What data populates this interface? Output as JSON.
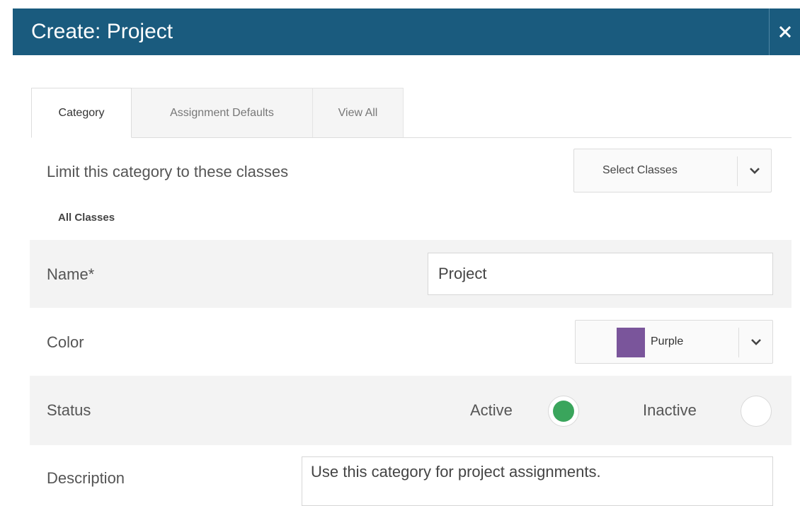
{
  "dialog": {
    "title": "Create: Project"
  },
  "tabs": [
    {
      "label": "Category",
      "active": true
    },
    {
      "label": "Assignment Defaults",
      "active": false
    },
    {
      "label": "View All",
      "active": false
    }
  ],
  "limit": {
    "label": "Limit this category to these classes",
    "select_label": "Select Classes",
    "current": "All Classes"
  },
  "name": {
    "label": "Name*",
    "value": "Project"
  },
  "color": {
    "label": "Color",
    "value": "Purple",
    "swatch": "#7a559b"
  },
  "status": {
    "label": "Status",
    "options": [
      {
        "label": "Active",
        "selected": true
      },
      {
        "label": "Inactive",
        "selected": false
      }
    ],
    "selected_color": "#3aa55c"
  },
  "description": {
    "label": "Description",
    "value": "Use this category for project assignments."
  },
  "theme": {
    "header_bg": "#1a5b7e"
  }
}
